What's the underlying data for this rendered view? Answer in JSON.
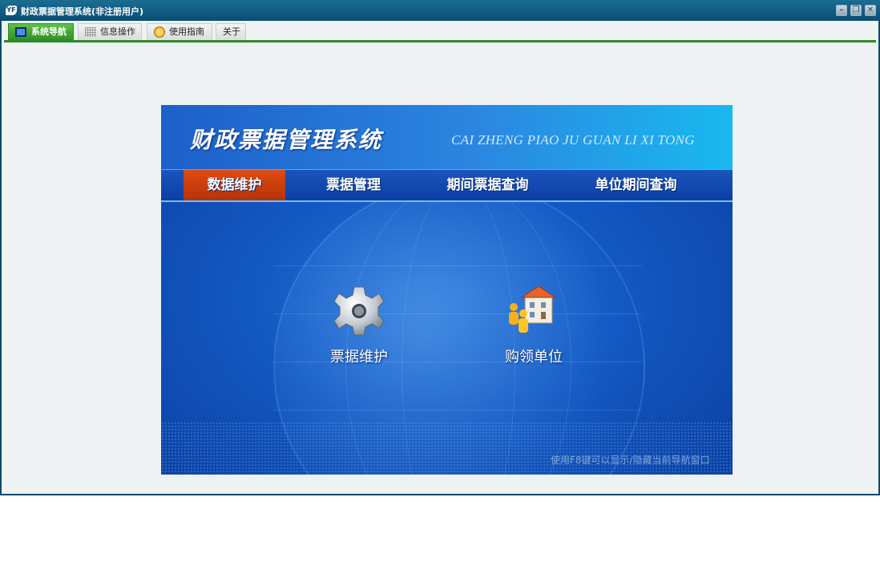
{
  "window": {
    "title": "财政票据管理系统(非注册用户)",
    "app_icon_text": "YF",
    "buttons": {
      "minimize": "–",
      "restore": "❐",
      "close": "✕"
    }
  },
  "tabs": [
    {
      "label": "系统导航",
      "icon": "monitor-icon",
      "active": true
    },
    {
      "label": "信息操作",
      "icon": "grid-icon",
      "active": false
    },
    {
      "label": "使用指南",
      "icon": "smiley-icon",
      "active": false
    },
    {
      "label": "关于",
      "icon": "",
      "active": false
    }
  ],
  "nav": {
    "logo_title": "财政票据管理系统",
    "logo_pinyin": "CAI ZHENG PIAO JU GUAN LI XI TONG",
    "menu": [
      {
        "label": "数据维护",
        "active": true
      },
      {
        "label": "票据管理",
        "active": false
      },
      {
        "label": "期间票据查询",
        "active": false
      },
      {
        "label": "单位期间查询",
        "active": false
      }
    ],
    "functions": [
      {
        "label": "票据维护",
        "icon": "gear-icon"
      },
      {
        "label": "购领单位",
        "icon": "building-people-icon"
      }
    ],
    "hint": "使用F8键可以显示/隐藏当前导航窗口"
  },
  "colors": {
    "titlebar": "#0b4a6e",
    "tab_active": "#2e8a2a",
    "menu_active": "#c9400a",
    "panel_blue": "#1358c2"
  }
}
